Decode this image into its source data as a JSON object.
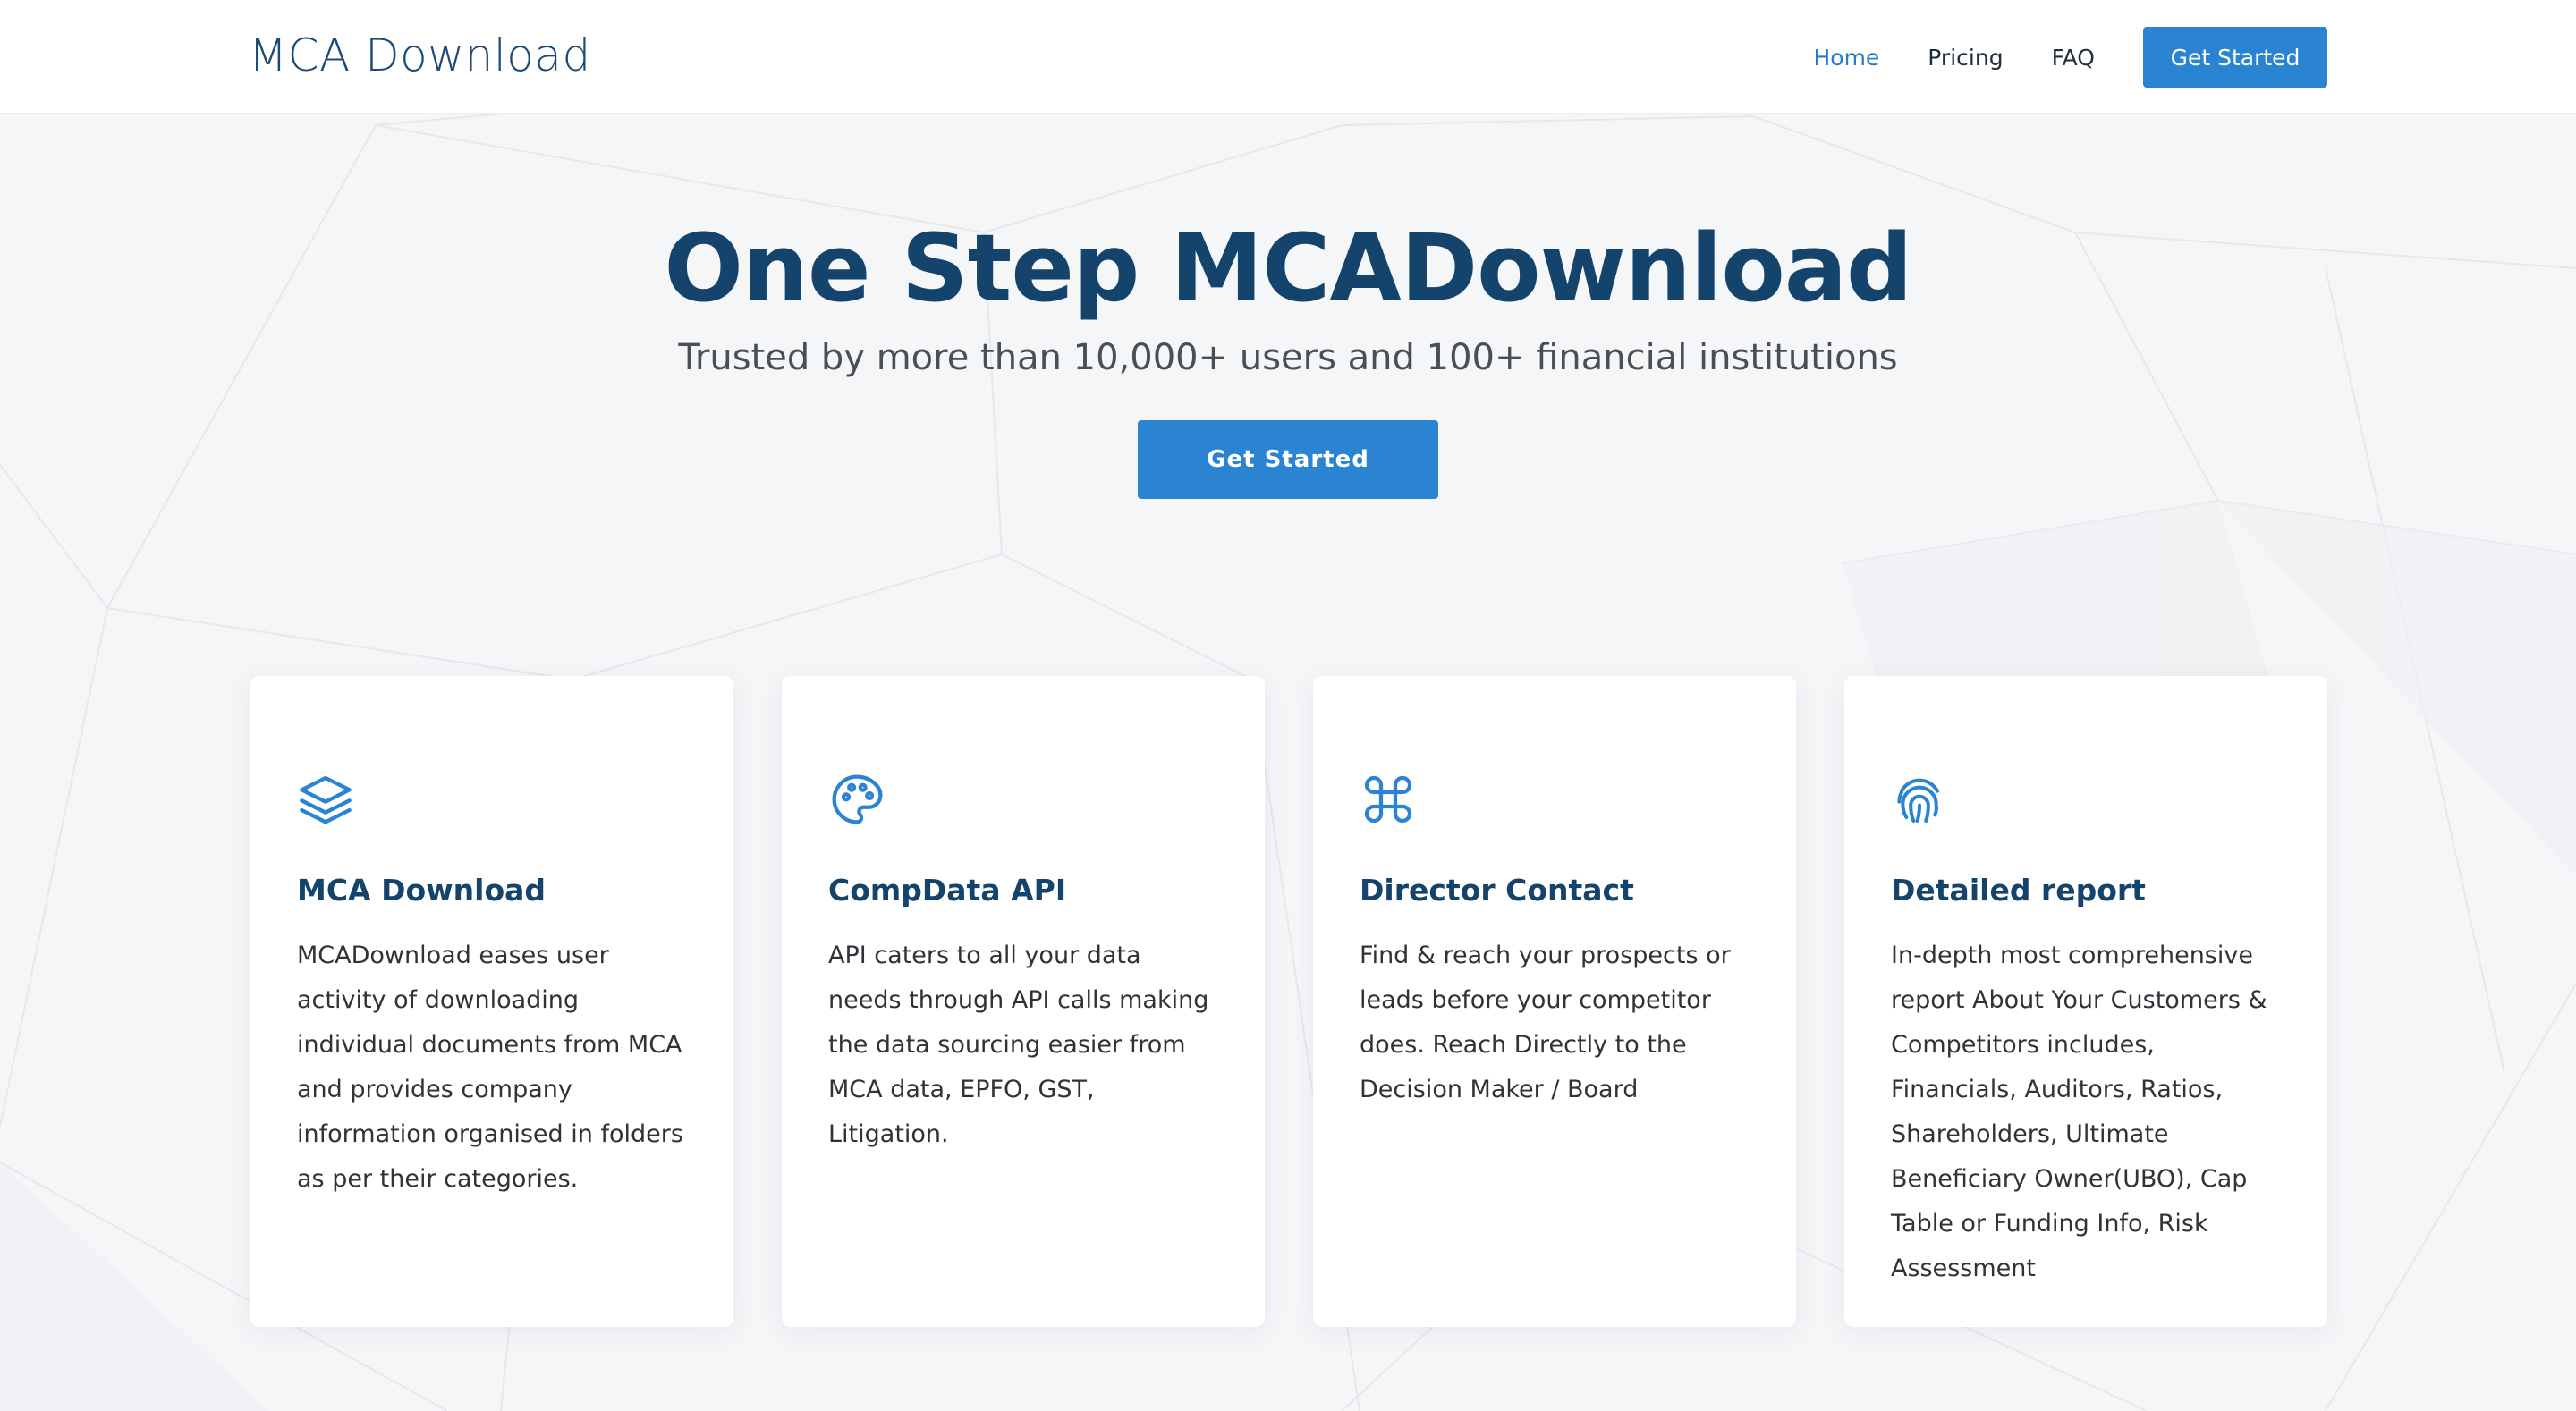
{
  "header": {
    "brand": "MCA Download",
    "nav": [
      {
        "label": "Home",
        "active": true
      },
      {
        "label": "Pricing",
        "active": false
      },
      {
        "label": "FAQ",
        "active": false
      }
    ],
    "cta_label": "Get Started"
  },
  "hero": {
    "title": "One Step MCADownload",
    "subtitle": "Trusted by more than 10,000+ users and 100+ financial institutions",
    "cta_label": "Get Started"
  },
  "cards": [
    {
      "icon": "layers-icon",
      "title": "MCA Download",
      "description": "MCADownload eases user activity of downloading individual documents from MCA and provides company information organised in folders as per their categories."
    },
    {
      "icon": "palette-icon",
      "title": "CompData API",
      "description": "API caters to all your data needs through API calls making the data sourcing easier from MCA data, EPFO, GST, Litigation."
    },
    {
      "icon": "command-icon",
      "title": "Director Contact",
      "description": "Find & reach your prospects or leads before your competitor does. Reach Directly to the Decision Maker / Board"
    },
    {
      "icon": "fingerprint-icon",
      "title": "Detailed report",
      "description": "In-depth most comprehensive report About Your Customers & Competitors includes, Financials, Auditors, Ratios, Shareholders, Ultimate Beneficiary Owner(UBO), Cap Table or Funding Info, Risk Assessment"
    }
  ],
  "colors": {
    "accent": "#2a84d2",
    "heading": "#14436b",
    "brand": "#1c4a78",
    "background": "#f5f6f8"
  }
}
